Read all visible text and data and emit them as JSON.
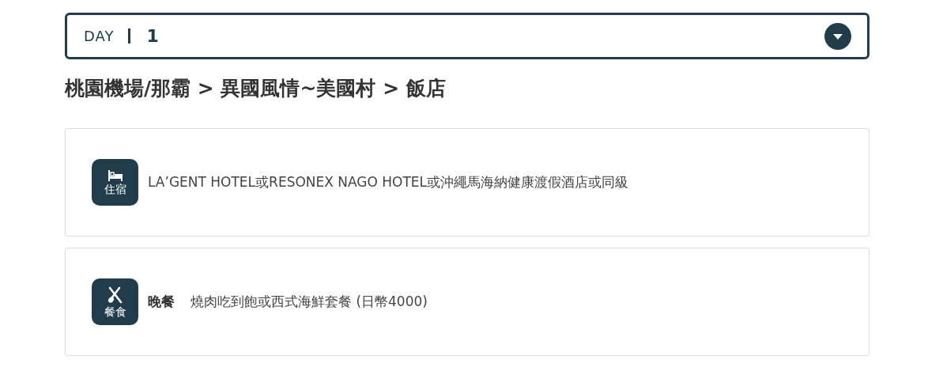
{
  "day_select": {
    "label": "DAY",
    "value": "1"
  },
  "route": "桃園機場/那霸 > 異國風情~美國村 > 飯店",
  "items": [
    {
      "kind": "hotel",
      "badge": "住宿",
      "text": "LA’GENT HOTEL或RESONEX NAGO HOTEL或沖繩馬海納健康渡假酒店或同級"
    },
    {
      "kind": "meal",
      "badge": "餐食",
      "label": "晚餐",
      "text": "燒肉吃到飽或西式海鮮套餐 (日幣4000)"
    }
  ]
}
